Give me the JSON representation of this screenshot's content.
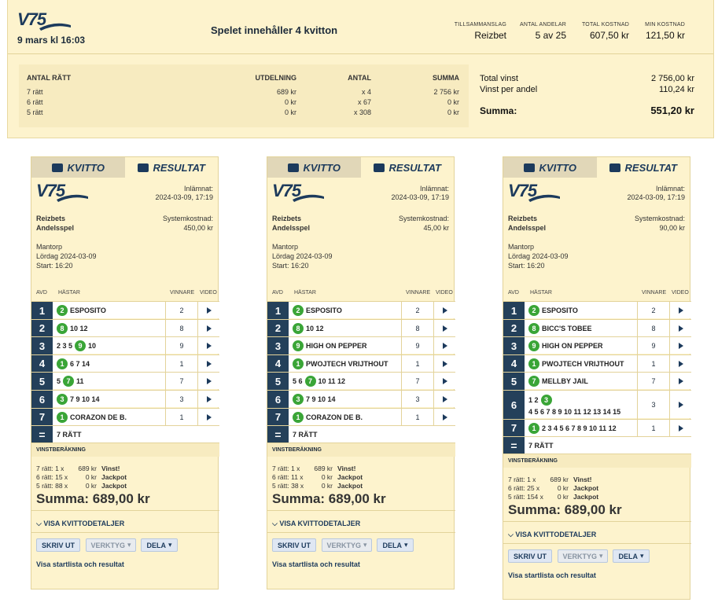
{
  "summary": {
    "logo": "V75",
    "date": "9 mars kl 16:03",
    "headline": "Spelet innehåller 4 kvitton",
    "stats": [
      {
        "label": "TILLSAMMANSLAG",
        "value": "Reizbet"
      },
      {
        "label": "ANTAL ANDELAR",
        "value": "5 av 25"
      },
      {
        "label": "TOTAL KOSTNAD",
        "value": "607,50 kr"
      },
      {
        "label": "MIN KOSTNAD",
        "value": "121,50 kr"
      }
    ],
    "table": {
      "headers": [
        "ANTAL RÄTT",
        "UTDELNING",
        "ANTAL",
        "SUMMA"
      ],
      "rows": [
        [
          "7 rätt",
          "689 kr",
          "x 4",
          "2 756 kr"
        ],
        [
          "6 rätt",
          "0 kr",
          "x 67",
          "0 kr"
        ],
        [
          "5 rätt",
          "0 kr",
          "x 308",
          "0 kr"
        ]
      ]
    },
    "totals": [
      {
        "label": "Total vinst",
        "value": "2 756,00 kr"
      },
      {
        "label": "Vinst per andel",
        "value": "110,24 kr"
      }
    ],
    "summa_label": "Summa:",
    "summa_value": "551,20 kr"
  },
  "common": {
    "tab_kvitto": "KVITTO",
    "tab_resultat": "RESULTAT",
    "logo": "V75",
    "inlamnat": "Inlämnat:",
    "systemkostnad": "Systemkostnad:",
    "syndicate": "Reizbets",
    "type": "Andelsspel",
    "track": "Mantorp",
    "day": "Lördag 2024-03-09",
    "start": "Start: 16:20",
    "h_avd": "AVD",
    "h_hastar": "HÄSTAR",
    "h_vinnare": "VINNARE",
    "h_video": "VIDEO",
    "eq": "=",
    "ratt": "7 RÄTT",
    "vinstberakning": "VINSTBERÄKNING",
    "summa": "Summa: 689,00 kr",
    "details": "VISA KVITTODETALJER",
    "skriv": "SKRIV UT",
    "verktyg": "VERKTYG",
    "dela": "DELA",
    "startlista": "Visa startlista och resultat"
  },
  "tickets": [
    {
      "date": "2024-03-09, 17:19",
      "cost": "450,00 kr",
      "rows": [
        {
          "avd": "1",
          "pill": "2",
          "pre": "",
          "post": "ESPOSITO",
          "win": "2"
        },
        {
          "avd": "2",
          "pill": "8",
          "pre": "",
          "post": "10 12",
          "win": "8"
        },
        {
          "avd": "3",
          "pill": "9",
          "pre": "2 3 5",
          "post": "10",
          "win": "9"
        },
        {
          "avd": "4",
          "pill": "1",
          "pre": "",
          "post": "6 7 14",
          "win": "1"
        },
        {
          "avd": "5",
          "pill": "7",
          "pre": "5",
          "post": "11",
          "win": "7"
        },
        {
          "avd": "6",
          "pill": "3",
          "pre": "",
          "post": "7 9 10 14",
          "win": "3"
        },
        {
          "avd": "7",
          "pill": "1",
          "pre": "",
          "post": "CORAZON DE B.",
          "win": "1"
        }
      ],
      "calc": [
        [
          "7 rätt: 1 x",
          "689 kr",
          "Vinst!"
        ],
        [
          "6 rätt: 15 x",
          "0 kr",
          "Jackpot"
        ],
        [
          "5 rätt: 88 x",
          "0 kr",
          "Jackpot"
        ]
      ]
    },
    {
      "date": "2024-03-09, 17:19",
      "cost": "45,00 kr",
      "rows": [
        {
          "avd": "1",
          "pill": "2",
          "pre": "",
          "post": "ESPOSITO",
          "win": "2"
        },
        {
          "avd": "2",
          "pill": "8",
          "pre": "",
          "post": "10 12",
          "win": "8"
        },
        {
          "avd": "3",
          "pill": "9",
          "pre": "",
          "post": "HIGH ON PEPPER",
          "win": "9"
        },
        {
          "avd": "4",
          "pill": "1",
          "pre": "",
          "post": "PWOJTECH VRIJTHOUT",
          "win": "1"
        },
        {
          "avd": "5",
          "pill": "7",
          "pre": "5 6",
          "post": "10 11 12",
          "win": "7"
        },
        {
          "avd": "6",
          "pill": "3",
          "pre": "",
          "post": "7 9 10 14",
          "win": "3"
        },
        {
          "avd": "7",
          "pill": "1",
          "pre": "",
          "post": "CORAZON DE B.",
          "win": "1"
        }
      ],
      "calc": [
        [
          "7 rätt: 1 x",
          "689 kr",
          "Vinst!"
        ],
        [
          "6 rätt: 11 x",
          "0 kr",
          "Jackpot"
        ],
        [
          "5 rätt: 38 x",
          "0 kr",
          "Jackpot"
        ]
      ]
    },
    {
      "date": "2024-03-09, 17:19",
      "cost": "90,00 kr",
      "rows": [
        {
          "avd": "1",
          "pill": "2",
          "pre": "",
          "post": "ESPOSITO",
          "win": "2"
        },
        {
          "avd": "2",
          "pill": "8",
          "pre": "",
          "post": "BICC'S TOBEE",
          "win": "8"
        },
        {
          "avd": "3",
          "pill": "9",
          "pre": "",
          "post": "HIGH ON PEPPER",
          "win": "9"
        },
        {
          "avd": "4",
          "pill": "1",
          "pre": "",
          "post": "PWOJTECH VRIJTHOUT",
          "win": "1"
        },
        {
          "avd": "5",
          "pill": "7",
          "pre": "",
          "post": "MELLBY JAIL",
          "win": "7"
        },
        {
          "avd": "6",
          "pill": "3",
          "pre": "1 2",
          "post": "4 5 6 7 8 9 10 11 12 13 14 15",
          "win": "3",
          "tall": true
        },
        {
          "avd": "7",
          "pill": "1",
          "pre": "",
          "post": "2 3 4 5 6 7 8 9 10 11 12",
          "win": "1"
        }
      ],
      "calc": [
        [
          "7 rätt: 1 x",
          "689 kr",
          "Vinst!"
        ],
        [
          "6 rätt: 25 x",
          "0 kr",
          "Jackpot"
        ],
        [
          "5 rätt: 154 x",
          "0 kr",
          "Jackpot"
        ]
      ]
    }
  ]
}
